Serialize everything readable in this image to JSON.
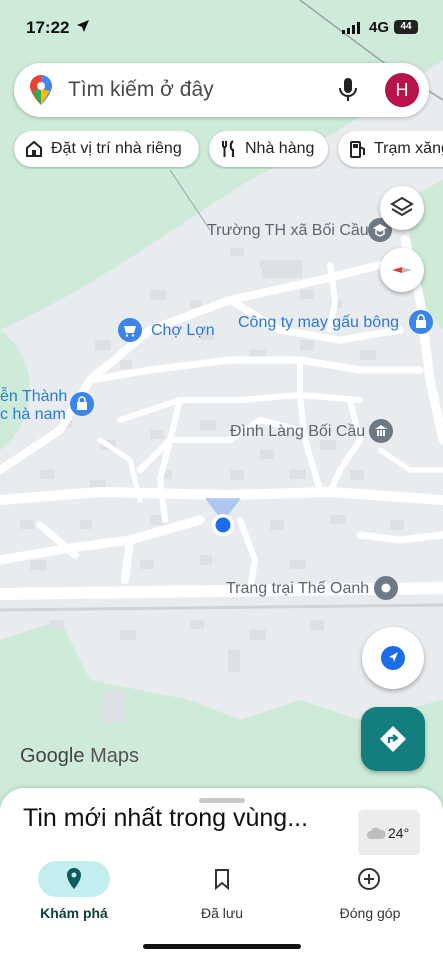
{
  "status": {
    "time": "17:22",
    "network": "4G",
    "battery": "44"
  },
  "search": {
    "placeholder": "Tìm kiếm ở đây",
    "avatar_initial": "H"
  },
  "chips": [
    {
      "label": "Đặt vị trí nhà riêng",
      "icon": "home-icon"
    },
    {
      "label": "Nhà hàng",
      "icon": "fork-knife-icon"
    },
    {
      "label": "Trạm xăng",
      "icon": "gas-station-icon"
    }
  ],
  "map": {
    "labels": {
      "school": "Trường TH xã Bối Cầu",
      "market": "Chợ Lợn",
      "company": "Công ty may gấu bông",
      "left_top": "ễn Thành",
      "left_bottom": "c hà nam",
      "temple": "Đình Làng Bối Cầu",
      "farm": "Trang trại Thế Oanh"
    },
    "colors": {
      "land": "#e9ecef",
      "green": "#c9ebd6",
      "road": "#ffffff",
      "poi_blue": "#3b84e8",
      "poi_gray": "#6d7a86",
      "text_blue": "#2d79d6",
      "text_gray": "#5d6670"
    }
  },
  "logo": {
    "google": "Google",
    "maps": "Maps"
  },
  "sheet": {
    "title": "Tin mới nhất trong vùng...",
    "temperature": "24°"
  },
  "nav": [
    {
      "label": "Khám phá",
      "icon": "explore-pin-icon",
      "active": true
    },
    {
      "label": "Đã lưu",
      "icon": "bookmark-icon",
      "active": false
    },
    {
      "label": "Đóng góp",
      "icon": "add-circle-icon",
      "active": false
    }
  ]
}
